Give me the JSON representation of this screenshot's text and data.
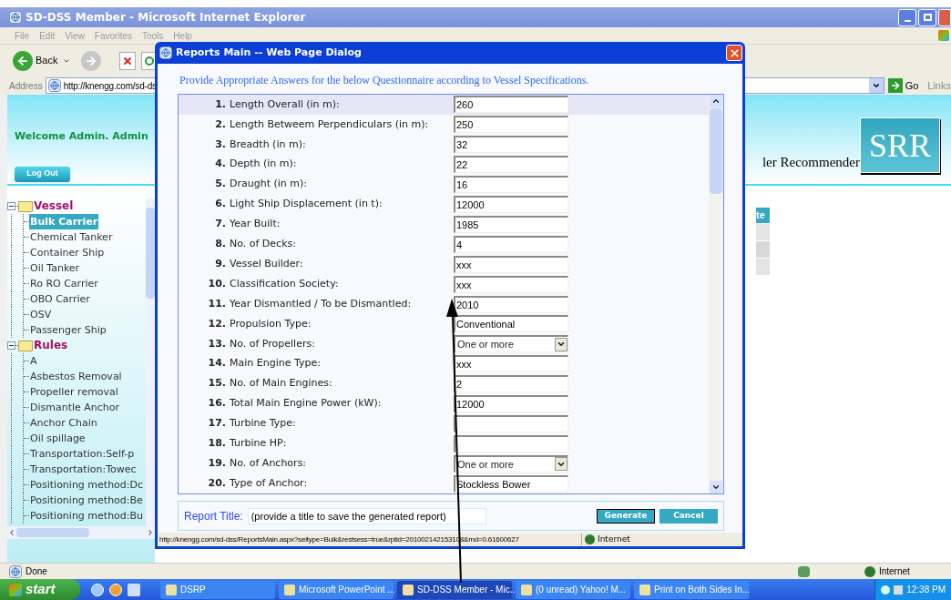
{
  "window": {
    "title": "SD-DSS Member - Microsoft Internet Explorer"
  },
  "menu": [
    "File",
    "Edit",
    "View",
    "Favorites",
    "Tools",
    "Help"
  ],
  "toolbar": {
    "back": "Back"
  },
  "address": {
    "label": "Address",
    "url": "http://knengg.com/sd-ds",
    "go": "Go",
    "links": "Links"
  },
  "page": {
    "welcome": "Welcome Admin. Admin",
    "logout": "Log Out",
    "header_text": "ler Recommender",
    "logo": "SRR",
    "table_header": "te"
  },
  "tree": [
    {
      "label": "Vessel",
      "expanded": true,
      "children": [
        {
          "label": "Bulk Carrier",
          "selected": true
        },
        {
          "label": "Chemical Tanker",
          "selected": false
        },
        {
          "label": "Container Ship",
          "selected": false
        },
        {
          "label": "Oil Tanker",
          "selected": false
        },
        {
          "label": "Ro RO Carrier",
          "selected": false
        },
        {
          "label": "OBO Carrier",
          "selected": false
        },
        {
          "label": "OSV",
          "selected": false
        },
        {
          "label": "Passenger Ship",
          "selected": false
        }
      ]
    },
    {
      "label": "Rules",
      "expanded": true,
      "children": [
        {
          "label": "A",
          "selected": false
        },
        {
          "label": "Asbestos Removal",
          "selected": false
        },
        {
          "label": "Propeller removal",
          "selected": false
        },
        {
          "label": "Dismantle Anchor",
          "selected": false
        },
        {
          "label": "Anchor Chain",
          "selected": false
        },
        {
          "label": "Oil spillage",
          "selected": false
        },
        {
          "label": "Transportation:Self-p",
          "selected": false
        },
        {
          "label": "Transportation:Towec",
          "selected": false
        },
        {
          "label": "Positioning method:Dc",
          "selected": false
        },
        {
          "label": "Positioning method:Be",
          "selected": false
        },
        {
          "label": "Positioning method:Bu",
          "selected": false
        }
      ]
    }
  ],
  "dialog": {
    "title": "Reports Main -- Web Page Dialog",
    "instruction": "Provide Appropriate Answers for the below Questionnaire according to Vessel Specifications.",
    "questions": [
      {
        "number": "1.",
        "label": "Length Overall (in m):",
        "kind": "text",
        "value": "260",
        "selected": true
      },
      {
        "number": "2.",
        "label": "Length Betweem Perpendiculars (in m):",
        "kind": "text",
        "value": "250",
        "selected": false
      },
      {
        "number": "3.",
        "label": "Breadth (in m):",
        "kind": "text",
        "value": "32",
        "selected": false
      },
      {
        "number": "4.",
        "label": "Depth (in m):",
        "kind": "text",
        "value": "22",
        "selected": false
      },
      {
        "number": "5.",
        "label": "Draught (in m):",
        "kind": "text",
        "value": "16",
        "selected": false
      },
      {
        "number": "6.",
        "label": "Light Ship Displacement (in t):",
        "kind": "text",
        "value": "12000",
        "selected": false
      },
      {
        "number": "7.",
        "label": "Year Built:",
        "kind": "text",
        "value": "1985",
        "selected": false
      },
      {
        "number": "8.",
        "label": "No. of Decks:",
        "kind": "text",
        "value": "4",
        "selected": false
      },
      {
        "number": "9.",
        "label": "Vessel Builder:",
        "kind": "text",
        "value": "xxx",
        "selected": false
      },
      {
        "number": "10.",
        "label": "Classification Society:",
        "kind": "text",
        "value": "xxx",
        "selected": false
      },
      {
        "number": "11.",
        "label": "Year Dismantled / To be Dismantled:",
        "kind": "text",
        "value": "2010",
        "selected": false
      },
      {
        "number": "12.",
        "label": "Propulsion Type:",
        "kind": "text",
        "value": "Conventional",
        "selected": false
      },
      {
        "number": "13.",
        "label": "No. of Propellers:",
        "kind": "select",
        "value": "One or more",
        "selected": false
      },
      {
        "number": "14.",
        "label": "Main Engine Type:",
        "kind": "text",
        "value": "xxx",
        "selected": false
      },
      {
        "number": "15.",
        "label": "No. of Main Engines:",
        "kind": "text",
        "value": "2",
        "selected": false
      },
      {
        "number": "16.",
        "label": "Total Main Engine Power (kW):",
        "kind": "text",
        "value": "12000",
        "selected": false
      },
      {
        "number": "17.",
        "label": "Turbine Type:",
        "kind": "text",
        "selected": false
      },
      {
        "number": "18.",
        "label": "Turbine HP:",
        "kind": "text",
        "selected": false
      },
      {
        "number": "19.",
        "label": "No. of Anchors:",
        "kind": "select",
        "value": "One or more",
        "selected": false
      },
      {
        "number": "20.",
        "label": "Type of Anchor:",
        "kind": "text",
        "value": "Stockless Bower",
        "selected": false
      }
    ],
    "report_title": {
      "label": "Report Title:",
      "value": "(provide a title to save the generated report)"
    },
    "buttons": [
      {
        "label": "Generate",
        "focused": true
      },
      {
        "label": "Cancel",
        "focused": false
      }
    ],
    "status_url": "http://knengg.com/sd-dss/ReportsMain.aspx?seltype=Bulk&restsess=true&rptid=201002142153108&rnd=0.61600627",
    "status_zone": "Internet"
  },
  "status_bar": {
    "text": "Done",
    "zone": "Internet"
  },
  "taskbar": {
    "start": "start",
    "items": [
      {
        "label": "DSRP",
        "selected": false
      },
      {
        "label": "Microsoft PowerPoint ...",
        "selected": false
      },
      {
        "label": "SD-DSS Member - Mic...",
        "selected": true
      },
      {
        "label": "(0 unread) Yahoo! M...",
        "selected": false
      },
      {
        "label": "Print on Both Sides In...",
        "selected": false
      }
    ],
    "clock": "12:38 PM"
  }
}
